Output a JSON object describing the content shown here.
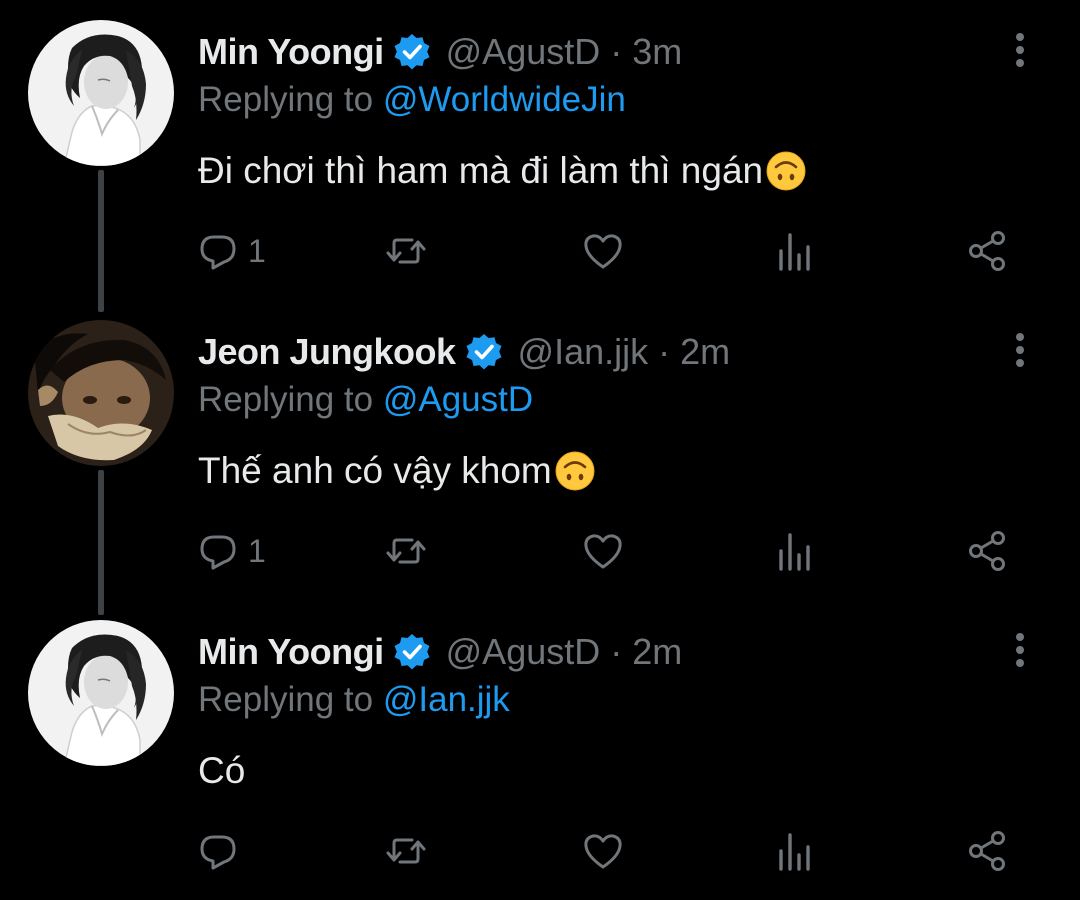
{
  "colors": {
    "background": "#000000",
    "primary_text": "#e7e9ea",
    "secondary_text": "#71767b",
    "accent": "#1d9bf0",
    "thread_line": "#3d4246"
  },
  "tweets": [
    {
      "display_name": "Min Yoongi",
      "handle": "@AgustD",
      "separator": "·",
      "time": "3m",
      "replying_prefix": "Replying to",
      "replying_to": "@WorldwideJin",
      "text": "Đi chơi thì ham mà đi làm thì ngán",
      "emoji": "upside-down-face",
      "reply_count": "1"
    },
    {
      "display_name": "Jeon Jungkook",
      "handle": "@Ian.jjk",
      "separator": "·",
      "time": "2m",
      "replying_prefix": "Replying to",
      "replying_to": "@AgustD",
      "text": "Thế anh có vậy khom",
      "emoji": "upside-down-face",
      "reply_count": "1"
    },
    {
      "display_name": "Min Yoongi",
      "handle": "@AgustD",
      "separator": "·",
      "time": "2m",
      "replying_prefix": "Replying to",
      "replying_to": "@Ian.jjk",
      "text": "Có",
      "emoji": "",
      "reply_count": ""
    }
  ],
  "icons": {
    "verified": "verified-badge-icon",
    "more": "more-options-icon",
    "reply": "reply-bubble-icon",
    "retweet": "retweet-icon",
    "like": "heart-icon",
    "views": "views-bar-chart-icon",
    "share": "share-icon"
  }
}
